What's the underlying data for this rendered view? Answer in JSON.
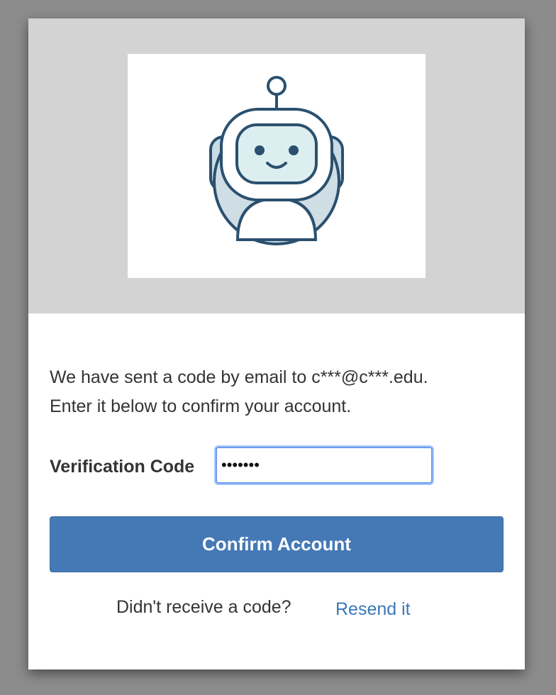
{
  "logo": {
    "icon": "robot-icon"
  },
  "message": {
    "line1": "We have sent a code by email to c***@c***.edu.",
    "line2": "Enter it below to confirm your account."
  },
  "verification": {
    "label": "Verification Code",
    "value": "1234567"
  },
  "confirm_button": {
    "label": "Confirm Account"
  },
  "resend": {
    "question": "Didn't receive a code?",
    "link": "Resend it"
  },
  "colors": {
    "brand": "#4479b5",
    "link": "#3b78b7",
    "banner": "#d3d3d3",
    "focus_ring": "#6c9cf0"
  }
}
